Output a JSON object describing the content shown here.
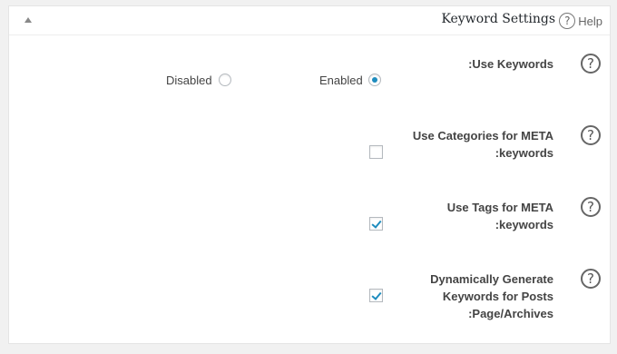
{
  "header": {
    "title": "Keyword Settings",
    "help_label": "Help",
    "help_icon": "?"
  },
  "help_icon_glyph": "?",
  "settings": {
    "use_keywords": {
      "label": ":Use Keywords",
      "options": {
        "disabled": "Disabled",
        "enabled": "Enabled"
      },
      "selected": "enabled"
    },
    "use_categories": {
      "label": "Use Categories for META\n:keywords",
      "checked": false
    },
    "use_tags": {
      "label": "Use Tags for META\n:keywords",
      "checked": true
    },
    "dynamic_keywords": {
      "label": "Dynamically Generate\nKeywords for Posts\n:Page/Archives",
      "checked": true
    }
  },
  "colors": {
    "accent": "#1e8cbe",
    "panel_bg": "#ffffff",
    "page_bg": "#f1f1f1"
  }
}
